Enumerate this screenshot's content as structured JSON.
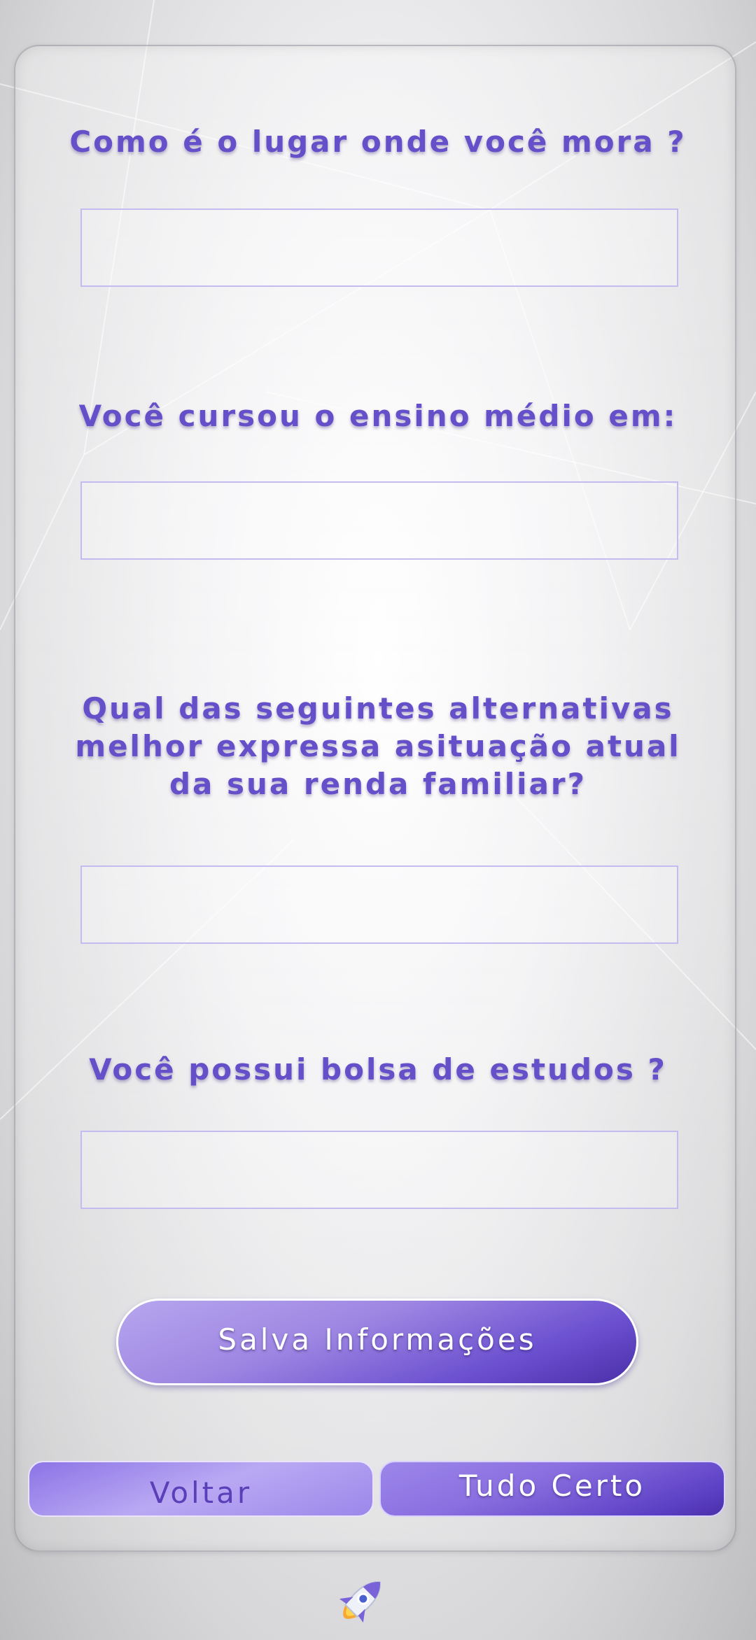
{
  "form": {
    "questions": [
      {
        "label": "Como é o lugar onde você mora ?",
        "value": ""
      },
      {
        "label": "Você cursou o ensino médio em:",
        "value": ""
      },
      {
        "label": "Qual das seguintes alternativas melhor expressa asituação atual da sua renda familiar?",
        "value": ""
      },
      {
        "label": "Você possui bolsa de estudos ?",
        "value": ""
      }
    ],
    "save_label": "Salva Informações"
  },
  "nav": {
    "back_label": "Voltar",
    "confirm_label": "Tudo Certo"
  },
  "icons": {
    "logo": "rocket-icon"
  },
  "colors": {
    "accent": "#6650c9",
    "button_dark": "#4a2fa8",
    "button_light": "#b7a6ee",
    "field_border": "#c4bbf1"
  }
}
